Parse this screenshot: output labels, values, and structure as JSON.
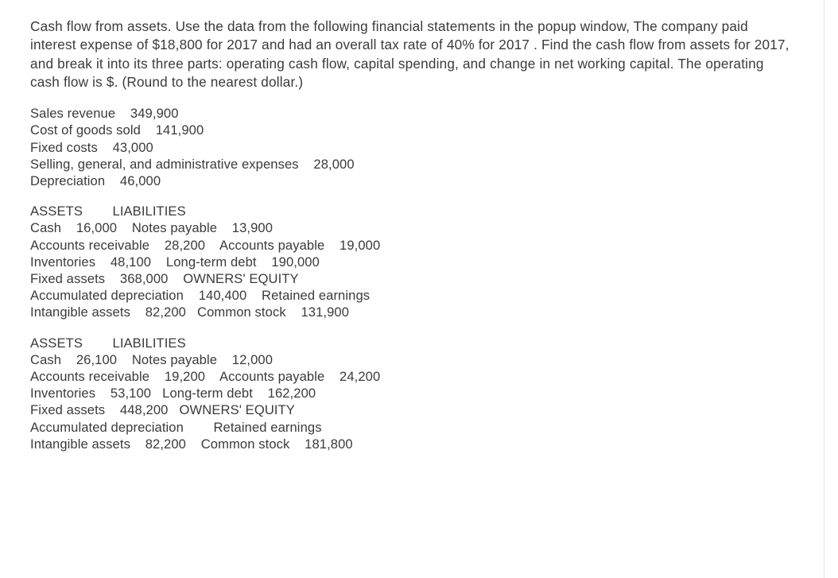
{
  "problem": {
    "statement": "Cash flow from assets. Use the data from the following financial statements in the popup window, The company paid interest expense of $18,800 for 2017 and had an overall tax rate of 40% for 2017 . Find the cash flow from assets for 2017, and break it into its three parts: operating cash flow, capital spending, and change in net working capital. The operating cash flow is $. (Round to the nearest dollar.)"
  },
  "income_statement": {
    "lines": [
      "Sales revenue    349,900",
      "Cost of goods sold    141,900",
      "Fixed costs    43,000",
      "Selling, general, and administrative expenses    28,000",
      "Depreciation    46,000"
    ]
  },
  "balance_sheet_1": {
    "lines": [
      "ASSETS        LIABILITIES",
      "Cash    16,000    Notes payable    13,900",
      "Accounts receivable    28,200    Accounts payable    19,000",
      "Inventories    48,100    Long-term debt    190,000",
      "Fixed assets    368,000    OWNERS' EQUITY",
      "Accumulated depreciation    140,400    Retained earnings",
      "Intangible assets    82,200   Common stock    131,900"
    ]
  },
  "balance_sheet_2": {
    "lines": [
      "ASSETS        LIABILITIES",
      "Cash    26,100    Notes payable    12,000",
      "Accounts receivable    19,200    Accounts payable    24,200",
      "Inventories    53,100   Long-term debt    162,200",
      "Fixed assets    448,200   OWNERS' EQUITY",
      "Accumulated depreciation        Retained earnings",
      "Intangible assets    82,200    Common stock    181,800"
    ]
  },
  "colors": {
    "text": "#3b3b3b",
    "background": "#ffffff",
    "divider": "#e3e3e3"
  }
}
